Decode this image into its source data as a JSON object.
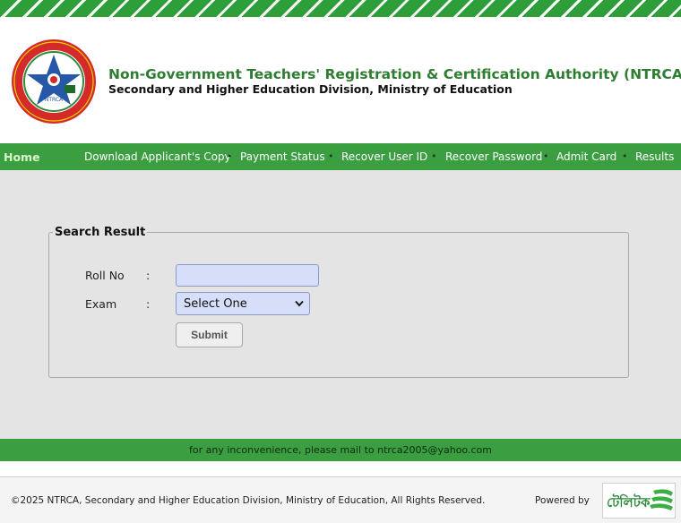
{
  "header": {
    "org_title": "Non-Government Teachers' Registration & Certification Authority (NTRCA)",
    "org_subtitle": "Secondary and Higher Education Division, Ministry of Education",
    "logo_text": "NTRCA"
  },
  "nav": {
    "home": "Home",
    "items": [
      "Download Applicant's Copy",
      "Payment Status",
      "Recover User ID",
      "Recover Password",
      "Admit Card",
      "Results"
    ],
    "separator": "•"
  },
  "search": {
    "legend": "Search Result",
    "roll_label": "Roll No",
    "exam_label": "Exam",
    "colon": ":",
    "roll_value": "",
    "exam_selected": "Select One",
    "submit_label": "Submit"
  },
  "notice": "for any inconvenience, please mail to ntrca2005@yahoo.com",
  "footer": {
    "copyright": "©2025 NTRCA, Secondary and Higher Education Division, Ministry of Education, All Rights Reserved.",
    "powered_by": "Powered by",
    "partner_logo_text": "টেলিটক"
  },
  "colors": {
    "brand_green": "#3b9e41",
    "title_green": "#2f7d32",
    "input_bg": "#d6defa"
  }
}
